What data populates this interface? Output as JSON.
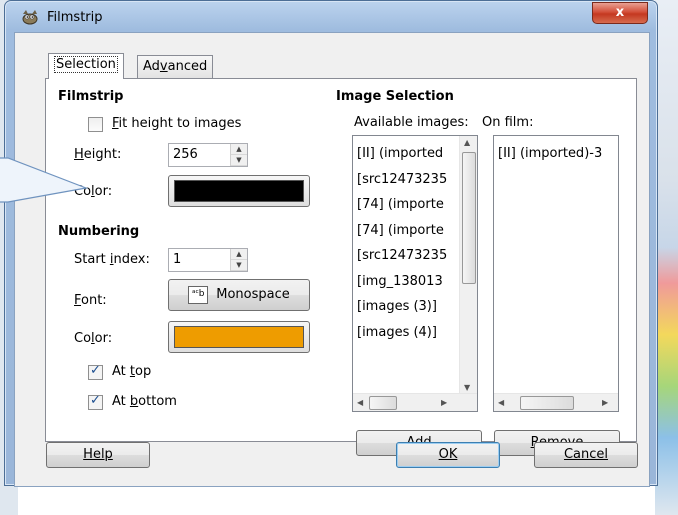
{
  "window": {
    "title": "Filmstrip",
    "close_label": "x"
  },
  "tabs": [
    {
      "label": "Selection",
      "active": true
    },
    {
      "label": "Advanced",
      "active": false
    }
  ],
  "filmstrip": {
    "heading": "Filmstrip",
    "fit_height_label": "Fit height to images",
    "fit_height_checked": false,
    "height_label": "Height:",
    "height_value": "256",
    "color_label": "Color:",
    "color_value": "#000000"
  },
  "numbering": {
    "heading": "Numbering",
    "start_index_label": "Start index:",
    "start_index_value": "1",
    "font_label": "Font:",
    "font_value": "Monospace",
    "font_icon": "font-picker-icon",
    "color_label": "Color:",
    "color_value": "#ee9c00",
    "at_top_label": "At top",
    "at_top_checked": true,
    "at_bottom_label": "At bottom",
    "at_bottom_checked": true
  },
  "image_selection": {
    "heading": "Image Selection",
    "available_label": "Available images:",
    "on_film_label": "On film:",
    "available_images": [
      "[II] (imported",
      "[src12473235",
      "[74] (importe",
      "[74] (importe",
      "[src12473235",
      "[img_138013",
      "[images (3)]",
      "[images (4)]"
    ],
    "on_film_images": [
      "[II] (imported)-3"
    ],
    "add_label": "Add",
    "remove_label": "Remove"
  },
  "footer": {
    "help_label": "Help",
    "ok_label": "OK",
    "cancel_label": "Cancel"
  }
}
